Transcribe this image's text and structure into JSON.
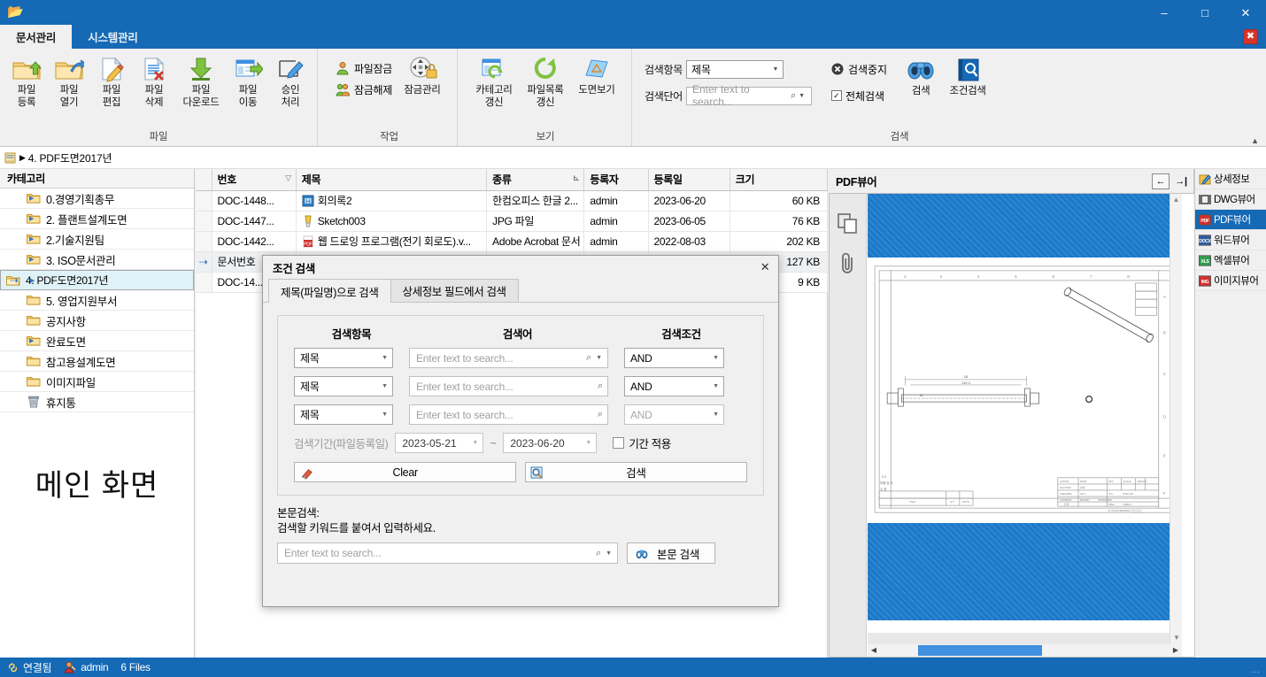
{
  "window": {
    "app_icon": "folder-open-icon",
    "minimize": "–",
    "maximize": "□",
    "close": "✕",
    "red_close_badge": "✖"
  },
  "ribbon": {
    "tabs": [
      {
        "label": "문서관리",
        "active": true
      },
      {
        "label": "시스템관리",
        "active": false
      }
    ],
    "collapse_icon": "▲",
    "groups": [
      {
        "name": "파일",
        "label": "파일",
        "buttons": [
          {
            "label": "파일\n등록",
            "icon": "folder-upload-icon"
          },
          {
            "label": "파일\n열기",
            "icon": "folder-open-arrow-icon"
          },
          {
            "label": "파일\n편집",
            "icon": "document-pencil-icon"
          },
          {
            "label": "파일\n삭제",
            "icon": "document-delete-icon"
          },
          {
            "label": "파일\n다운로드",
            "icon": "download-icon"
          },
          {
            "label": "파일\n이동",
            "icon": "move-right-icon"
          },
          {
            "label": "승인\n처리",
            "icon": "approve-pencil-icon"
          }
        ]
      },
      {
        "name": "작업",
        "label": "작업",
        "small_buttons": [
          {
            "label": "파일잠금",
            "icon": "user-lock-icon"
          },
          {
            "label": "잠금해제",
            "icon": "users-unlock-icon"
          }
        ],
        "buttons": [
          {
            "label": "잠금관리",
            "icon": "lock-manage-icon"
          }
        ]
      },
      {
        "name": "보기",
        "label": "보기",
        "buttons": [
          {
            "label": "카테고리\n갱신",
            "icon": "category-refresh-icon"
          },
          {
            "label": "파일목록\n갱신",
            "icon": "list-refresh-icon"
          },
          {
            "label": "도면보기",
            "icon": "drawing-view-icon"
          }
        ]
      },
      {
        "name": "검색",
        "label": "검색",
        "field_label": "검색항목",
        "field_value": "제목",
        "term_label": "검색단어",
        "term_placeholder": "Enter text to search...",
        "stop_label": "검색중지",
        "stop_icon": "stop-circle-icon",
        "check_label": "전체검색",
        "check_checked": "✓",
        "buttons": [
          {
            "label": "검색",
            "icon": "binoculars-icon"
          },
          {
            "label": "조건검색",
            "icon": "search-book-icon"
          }
        ]
      }
    ]
  },
  "breadcrumb": {
    "icon": "page-icon",
    "arrow": "▶",
    "text": "4. PDF도면2017년"
  },
  "tree": {
    "header": "카테고리",
    "current_marker": "⇢",
    "main_label": "메인 화면",
    "items": [
      {
        "label": "0.경영기획총무",
        "expandable": true,
        "icon": "folder-icon",
        "selected": false
      },
      {
        "label": "2. 플랜트설계도면",
        "expandable": true,
        "icon": "folder-icon",
        "selected": false
      },
      {
        "label": "2.기술지원팀",
        "expandable": true,
        "icon": "folder-icon",
        "selected": false
      },
      {
        "label": "3. ISO문서관리",
        "expandable": true,
        "icon": "folder-icon",
        "selected": false
      },
      {
        "label": "4. PDF도면2017년",
        "expandable": true,
        "icon": "folder-open-icon",
        "selected": true
      },
      {
        "label": "5. 영업지원부서",
        "expandable": false,
        "icon": "folder-icon",
        "selected": false
      },
      {
        "label": "공지사항",
        "expandable": false,
        "icon": "folder-icon",
        "selected": false
      },
      {
        "label": "완료도면",
        "expandable": true,
        "icon": "folder-icon",
        "selected": false
      },
      {
        "label": "참고용설계도면",
        "expandable": false,
        "icon": "folder-icon",
        "selected": false
      },
      {
        "label": "이미지파일",
        "expandable": false,
        "icon": "folder-icon",
        "selected": false
      },
      {
        "label": "휴지통",
        "expandable": false,
        "icon": "trash-icon",
        "selected": false
      }
    ]
  },
  "grid": {
    "columns": [
      {
        "label": "번호",
        "sort_icon": "filter-icon"
      },
      {
        "label": "제목",
        "sort_icon": ""
      },
      {
        "label": "종류",
        "sort_icon": "sort-icon"
      },
      {
        "label": "등록자",
        "sort_icon": ""
      },
      {
        "label": "등록일",
        "sort_icon": ""
      },
      {
        "label": "크기",
        "sort_icon": ""
      }
    ],
    "rows": [
      {
        "mark": "",
        "no": "DOC-1448...",
        "title": "회의록2",
        "title_icon": "hwp-icon",
        "kind": "한컴오피스 한글 2...",
        "author": "admin",
        "date": "2023-06-20",
        "size": "60 KB",
        "selected": false
      },
      {
        "mark": "",
        "no": "DOC-1447...",
        "title": "Sketch003",
        "title_icon": "jpg-icon",
        "kind": "JPG 파일",
        "author": "admin",
        "date": "2023-06-05",
        "size": "76 KB",
        "selected": false
      },
      {
        "mark": "",
        "no": "DOC-1442...",
        "title": "웹 드로잉 프로그램(전기 회로도).v...",
        "title_icon": "pdf-icon",
        "kind": "Adobe Acrobat 문서",
        "author": "admin",
        "date": "2022-08-03",
        "size": "202 KB",
        "selected": false
      },
      {
        "mark": "⇢",
        "no": "문서번호",
        "title": "",
        "title_icon": "pdf-icon",
        "kind": "",
        "author": "",
        "date": "",
        "size": "127 KB",
        "selected": true
      },
      {
        "mark": "",
        "no": "DOC-14...",
        "title": "",
        "title_icon": "",
        "kind": "",
        "author": "",
        "date": "",
        "size": "9 KB",
        "selected": false
      }
    ]
  },
  "viewer": {
    "title": "PDF뷰어",
    "collapse_left_icon": "←",
    "collapse_right_icon": "→|",
    "tools": [
      {
        "icon": "pages-thumbnail-icon"
      },
      {
        "icon": "attachment-clip-icon"
      }
    ],
    "scroll_up": "▲",
    "scroll_down": "▼",
    "scroll_left": "◀",
    "scroll_right": "▶"
  },
  "right_strip": {
    "items": [
      {
        "label": "상세정보",
        "icon": "info-pencil-icon",
        "active": false,
        "badge": ""
      },
      {
        "label": "DWG뷰어",
        "icon": "dwg-icon",
        "active": false,
        "badge": ""
      },
      {
        "label": "PDF뷰어",
        "icon": "pdf-icon",
        "active": true,
        "badge": "PDF"
      },
      {
        "label": "워드뷰어",
        "icon": "docx-icon",
        "active": false,
        "badge": "DOCX"
      },
      {
        "label": "엑셀뷰어",
        "icon": "xls-icon",
        "active": false,
        "badge": "XLS"
      },
      {
        "label": "이미지뷰어",
        "icon": "img-icon",
        "active": false,
        "badge": "IMG"
      }
    ]
  },
  "dialog": {
    "title": "조건 검색",
    "close_icon": "✕",
    "tabs": [
      {
        "label": "제목(파일명)으로 검색",
        "active": true
      },
      {
        "label": "상세정보 필드에서 검색",
        "active": false
      }
    ],
    "headers": {
      "field": "검색항목",
      "term": "검색어",
      "condition": "검색조건"
    },
    "rows": [
      {
        "field": "제목",
        "term_placeholder": "Enter text to search...",
        "condition": "AND",
        "has_caret": true,
        "cond_disabled": false
      },
      {
        "field": "제목",
        "term_placeholder": "Enter text to search...",
        "condition": "AND",
        "has_caret": false,
        "cond_disabled": false
      },
      {
        "field": "제목",
        "term_placeholder": "Enter text to search...",
        "condition": "AND",
        "has_caret": false,
        "cond_disabled": true
      }
    ],
    "date": {
      "label": "검색기간(파일등록일)",
      "from": "2023-05-21",
      "to": "2023-06-20",
      "separator": "~",
      "apply_label": "기간 적용"
    },
    "buttons": {
      "clear": "Clear",
      "clear_icon": "eraser-icon",
      "search": "검색",
      "search_icon": "search-magnifier-icon"
    },
    "fulltext": {
      "caption_line1": "본문검색:",
      "caption_line2": "검색할 키워드를 붙여서 입력하세요.",
      "placeholder": "Enter text to search...",
      "button_label": "본문 검색",
      "button_icon": "binoculars-icon"
    }
  },
  "statusbar": {
    "connection_icon": "link-icon",
    "connection": "연결됨",
    "user_icon": "user-icon",
    "user": "admin",
    "files": "6 Files",
    "grip": "..."
  },
  "colors": {
    "accent": "#1569b5",
    "selection": "#dff2f7",
    "danger": "#d9342b",
    "viewer_blue": "#1b79c9"
  }
}
